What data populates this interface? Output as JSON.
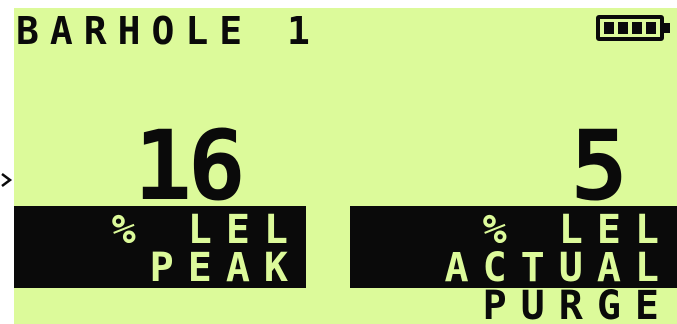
{
  "header": {
    "title": "BARHOLE 1",
    "battery_level": 1.0,
    "battery_cells": 4
  },
  "readings": {
    "peak": {
      "value": "16",
      "unit": "% LEL",
      "label": "PEAK"
    },
    "actual": {
      "value": "5",
      "unit": "% LEL",
      "label": "ACTUAL"
    }
  },
  "footer": {
    "mode": "PURGE"
  },
  "colors": {
    "lcd_background": "#dcfa9a",
    "lcd_foreground": "#0a0a0a"
  }
}
